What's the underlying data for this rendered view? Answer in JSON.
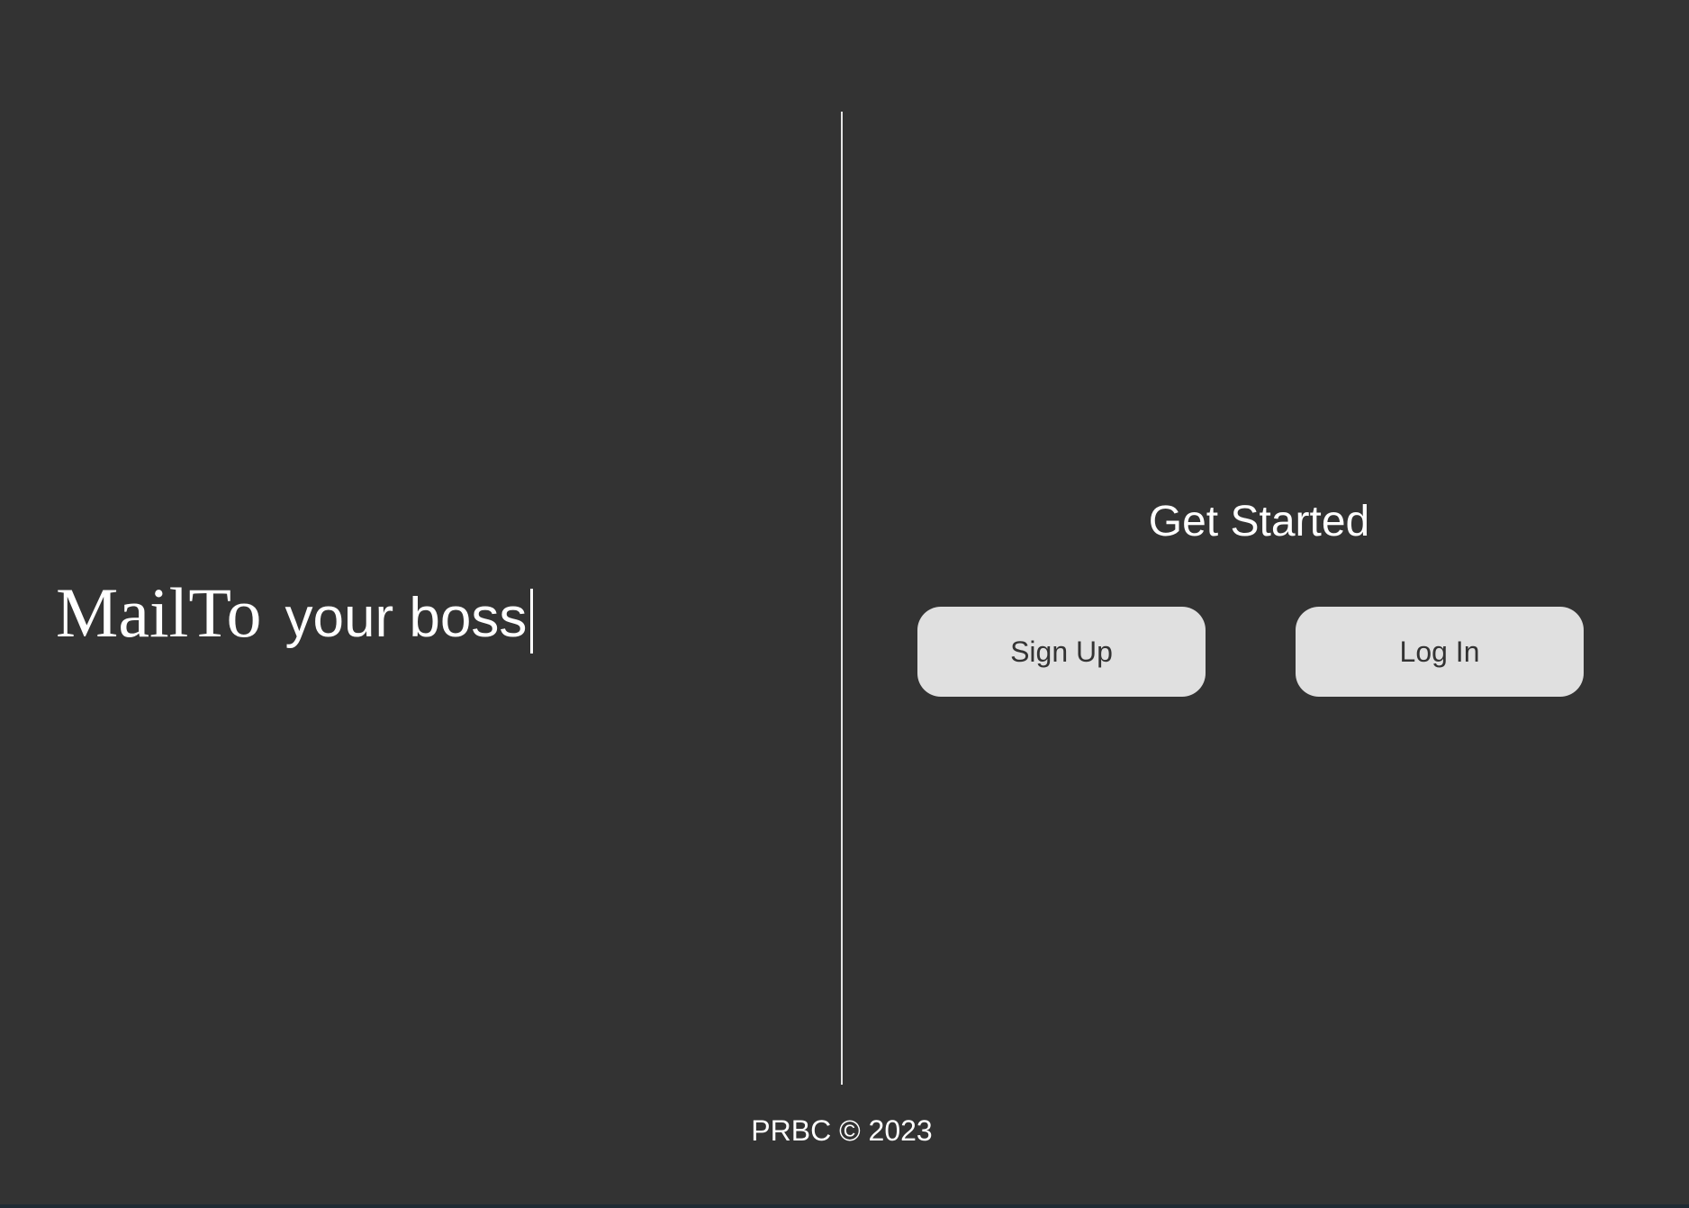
{
  "hero": {
    "brand": "MailTo",
    "typed_text": "your boss"
  },
  "auth": {
    "heading": "Get Started",
    "signup_label": "Sign Up",
    "login_label": "Log In"
  },
  "footer": {
    "text": "PRBC © 2023"
  },
  "colors": {
    "background": "#333333",
    "text": "#ffffff",
    "button_bg": "#e0e0e0",
    "button_text": "#333333",
    "divider": "#e6e6e6"
  }
}
